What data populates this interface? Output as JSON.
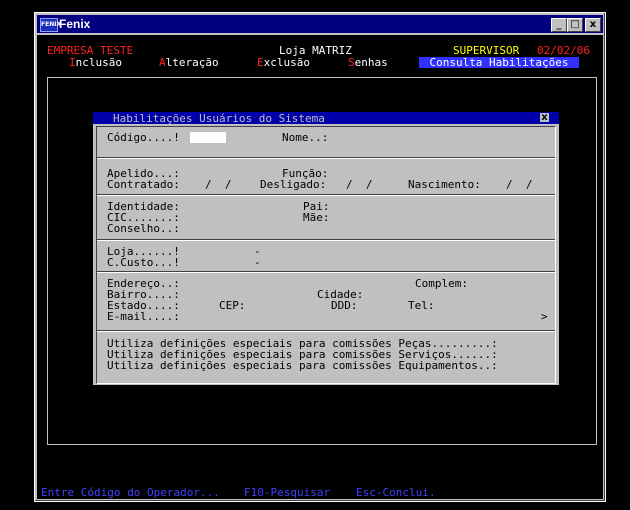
{
  "window": {
    "title": "Fenix",
    "icon": "fenix-app-icon",
    "icon_text": "FENIX"
  },
  "header": {
    "company": "EMPRESA TESTE",
    "store": "Loja MATRIZ",
    "user": "SUPERVISOR",
    "date": "02/02/06"
  },
  "menu": {
    "items": [
      {
        "hot": "I",
        "rest": "nclusão"
      },
      {
        "hot": "A",
        "rest": "lteração"
      },
      {
        "hot": "E",
        "rest": "xclusão"
      },
      {
        "hot": "S",
        "rest": "enhas"
      }
    ],
    "active": "Consulta Habilitações"
  },
  "dialog": {
    "title": "Habilitações Usuários do Sistema",
    "close": "x",
    "fields": {
      "codigo": "Código....!",
      "nome": "Nome..:",
      "apelido": "Apelido...:",
      "funcao": "Função:",
      "contratado": "Contratado:",
      "contratado_val": "/  /",
      "desligado": "Desligado:",
      "desligado_val": "/  /",
      "nascimento": "Nascimento:",
      "nascimento_val": "/  /",
      "identidade": "Identidade:",
      "pai": "Pai:",
      "cic": "CIC.......:",
      "mae": "Mãe:",
      "conselho": "Conselho..:",
      "loja": "Loja......!",
      "loja_sep": "-",
      "ccusto": "C.Custo...!",
      "ccusto_sep": "-",
      "endereco": "Endereço..:",
      "complem": "Complem:",
      "bairro": "Bairro....:",
      "cidade": "Cidade:",
      "estado": "Estado....:",
      "cep": "CEP:",
      "ddd": "DDD:",
      "tel": "Tel:",
      "email": "E-mail....:",
      "more": ">"
    },
    "commissions": [
      "Utiliza definições especiais para comissões Peças.........:",
      "Utiliza definições especiais para comissões Serviços......:",
      "Utiliza definições especiais para comissões Equipamentos..:"
    ]
  },
  "footer": {
    "hint": "Entre Código do Operador...",
    "f10": "F10-Pesquisar",
    "esc": "Esc-Conclui."
  },
  "colors": {
    "company": "#ff2020",
    "user": "#ffff00",
    "date": "#ff2020",
    "menu_hot": "#ff2020",
    "menu_text": "#ffffff",
    "active_bg": "#3030ff",
    "footer": "#4040ff"
  }
}
